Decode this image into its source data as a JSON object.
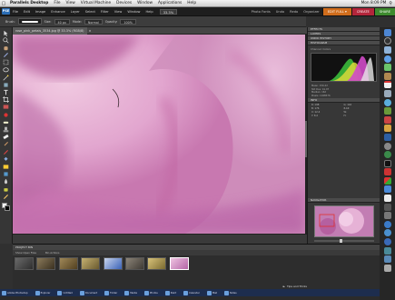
{
  "mac_menubar": {
    "apple": "",
    "app": "Parallels Desktop",
    "items": [
      "File",
      "View",
      "Virtual Machine",
      "Devices",
      "Window",
      "Applications",
      "Help"
    ],
    "clock": "Mon 8:09 PM"
  },
  "pse": {
    "logo": "PSE",
    "menu": [
      "File",
      "Edit",
      "Image",
      "Enhance",
      "Layer",
      "Select",
      "Filter",
      "View",
      "Window",
      "Help"
    ],
    "zoom": "33.3%",
    "mode_tabs": {
      "edit": "EDIT FULL ▾",
      "create": "CREATE",
      "share": "SHARE"
    },
    "top_right": [
      "Photo Fonts",
      "Undo",
      "Redo",
      "Organizer"
    ]
  },
  "options": {
    "preset_label": "Brush:",
    "size_label": "Size:",
    "size_value": "40 px",
    "mode_label": "Mode:",
    "mode_value": "Normal",
    "opacity_label": "Opacity:",
    "opacity_value": "100%"
  },
  "doc": {
    "tab_title": "rose_pink_petals_3534.jpg @ 33.3% (RGB/8)",
    "close": "×"
  },
  "panels": {
    "effects": "EFFECTS",
    "layers": "LAYERS",
    "undo": "UNDO HISTORY",
    "histogram": "HISTOGRAM",
    "channel": "Channel: Colors",
    "stats": [
      "Mean: 156.42",
      "Std Dev: 41.07",
      "Median: 162",
      "Pixels: 1048576"
    ],
    "info": "INFO",
    "info_values": [
      "R: 198",
      "G: 142",
      "B: 176",
      "8-bit",
      "X: 12.4",
      "W:",
      "Y: 8.2",
      "H:"
    ],
    "navigator": "NAVIGATOR"
  },
  "project_bin": {
    "header": "PROJECT BIN",
    "toolbar": [
      "Show Open Files",
      "Bin Actions"
    ],
    "footer": "Tips and Tricks"
  },
  "taskbar": [
    "Adobe Photoshop",
    "Explorer",
    "Untitled",
    "Document",
    "Folder",
    "Media",
    "Photos",
    "Paint",
    "Calendar",
    "Mail",
    "Notes"
  ],
  "colors": {
    "edit_tab": "#d06d1c",
    "create_tab": "#b3263b",
    "share_tab": "#3d8a2e",
    "petal_pink": "#d9a0c8"
  },
  "icons": [
    "apple-icon",
    "move-tool-icon",
    "zoom-tool-icon",
    "hand-tool-icon",
    "eyedropper-icon",
    "marquee-icon",
    "lasso-icon",
    "magic-wand-icon",
    "brush-icon",
    "eraser-icon",
    "text-icon",
    "crop-icon"
  ]
}
